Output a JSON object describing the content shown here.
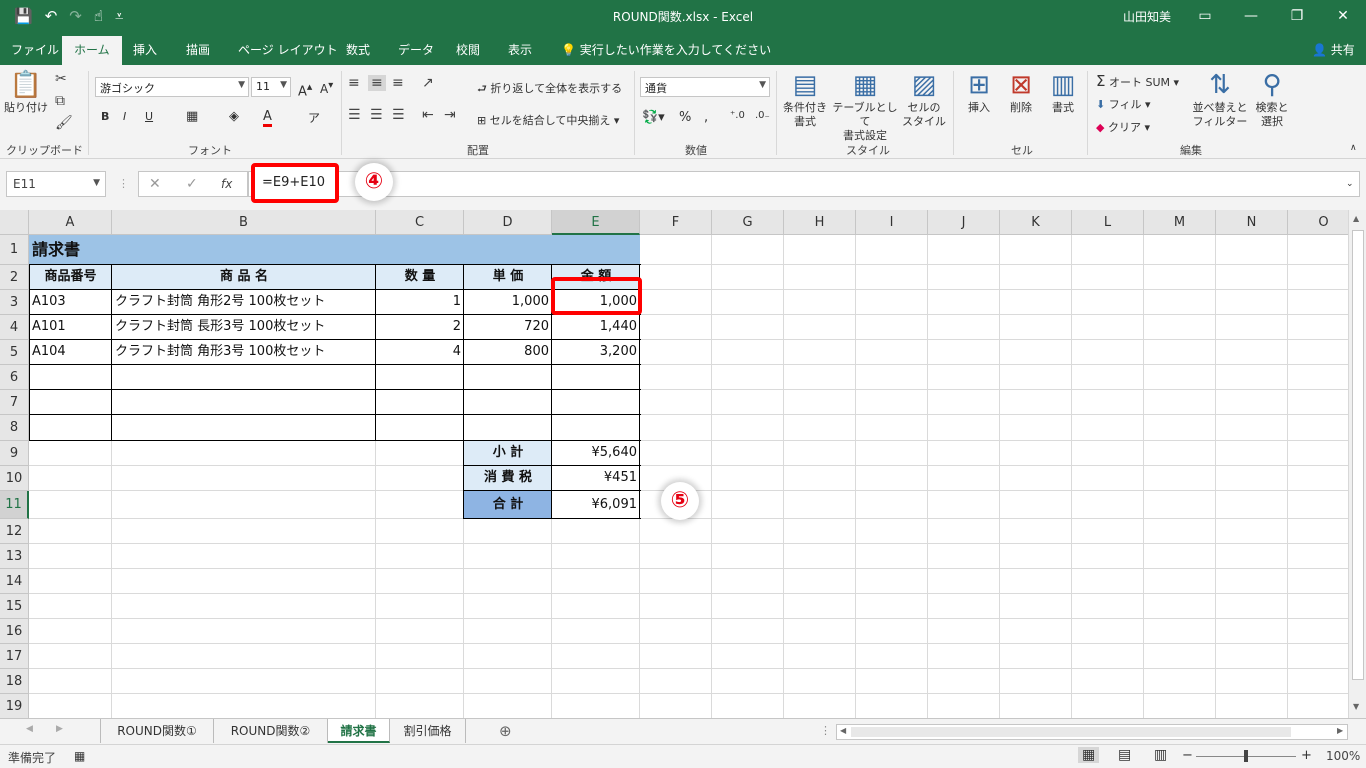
{
  "titlebar": {
    "title": "ROUND関数.xlsx  -  Excel",
    "user": "山田知美"
  },
  "tabs": {
    "items": [
      "ファイル",
      "ホーム",
      "挿入",
      "描画",
      "ページ レイアウト",
      "数式",
      "データ",
      "校閲",
      "表示"
    ],
    "tell_me": "実行したい作業を入力してください",
    "share": "共有"
  },
  "ribbon": {
    "clipboard": {
      "label": "クリップボード",
      "paste": "貼り付け"
    },
    "font": {
      "label": "フォント",
      "name": "游ゴシック",
      "size": "11"
    },
    "alignment": {
      "label": "配置",
      "wrap": "折り返して全体を表示する",
      "merge": "セルを結合して中央揃え"
    },
    "number": {
      "label": "数値",
      "format": "通貨"
    },
    "styles": {
      "label": "スタイル",
      "conditional_1": "条件付き",
      "conditional_2": "書式",
      "table_1": "テーブルとして",
      "table_2": "書式設定",
      "cell_1": "セルの",
      "cell_2": "スタイル"
    },
    "cells": {
      "label": "セル",
      "insert": "挿入",
      "delete": "削除",
      "format": "書式"
    },
    "editing": {
      "label": "編集",
      "autosum": "オート SUM",
      "fill": "フィル",
      "clear": "クリア",
      "sort_1": "並べ替えと",
      "sort_2": "フィルター",
      "find_1": "検索と",
      "find_2": "選択"
    }
  },
  "formula_bar": {
    "name_box": "E11",
    "formula": "=E9+E10",
    "fx": "fx"
  },
  "badges": {
    "step4": "④",
    "step5": "⑤"
  },
  "columns": [
    "A",
    "B",
    "C",
    "D",
    "E",
    "F",
    "G",
    "H",
    "I",
    "J",
    "K",
    "L",
    "M",
    "N",
    "O"
  ],
  "rows": [
    "1",
    "2",
    "3",
    "4",
    "5",
    "6",
    "7",
    "8",
    "9",
    "10",
    "11",
    "12",
    "13",
    "14",
    "15",
    "16",
    "17",
    "18",
    "19"
  ],
  "sheet": {
    "title": "請求書",
    "headers": [
      "商品番号",
      "商 品 名",
      "数 量",
      "単 価",
      "金 額"
    ],
    "items": [
      {
        "code": "A103",
        "name": "クラフト封筒 角形2号 100枚セット",
        "qty": "1",
        "price": "1,000",
        "amount": "1,000"
      },
      {
        "code": "A101",
        "name": "クラフト封筒 長形3号 100枚セット",
        "qty": "2",
        "price": "720",
        "amount": "1,440"
      },
      {
        "code": "A104",
        "name": "クラフト封筒 角形3号 100枚セット",
        "qty": "4",
        "price": "800",
        "amount": "3,200"
      }
    ],
    "subtotal_label": "小 計",
    "subtotal": "¥5,640",
    "tax_label": "消 費 税",
    "tax": "¥451",
    "total_label": "合 計",
    "total": "¥6,091"
  },
  "sheet_tabs": [
    "ROUND関数①",
    "ROUND関数②",
    "請求書",
    "割引価格"
  ],
  "statusbar": {
    "ready": "準備完了",
    "zoom": "100%"
  },
  "colors": {
    "excel_green": "#217346",
    "header_blue": "#9dc3e6",
    "light_blue": "#ddebf7",
    "total_blue": "#8eb4e3",
    "highlight_red": "#ff0000"
  }
}
